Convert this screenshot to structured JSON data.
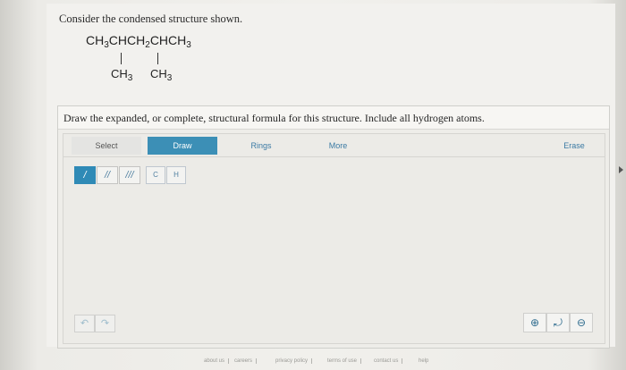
{
  "question": "Consider the condensed structure shown.",
  "structure": {
    "main_chain": "CH3CHCH2CHCH3",
    "branch_left": "CH3",
    "branch_right": "CH3"
  },
  "instruction": "Draw the expanded, or complete, structural formula for this structure. Include all hydrogen atoms.",
  "toolbar": {
    "select": "Select",
    "draw": "Draw",
    "rings": "Rings",
    "more": "More",
    "erase": "Erase"
  },
  "bond_tools": [
    "/",
    "//",
    "///"
  ],
  "atom_tools": [
    "C",
    "H"
  ],
  "footer": [
    "about us",
    "careers",
    "privacy policy",
    "terms of use",
    "contact us",
    "help"
  ],
  "colors": {
    "accent": "#3c8fb6",
    "page": "#f2f1ee",
    "link": "#3b7aa4"
  }
}
